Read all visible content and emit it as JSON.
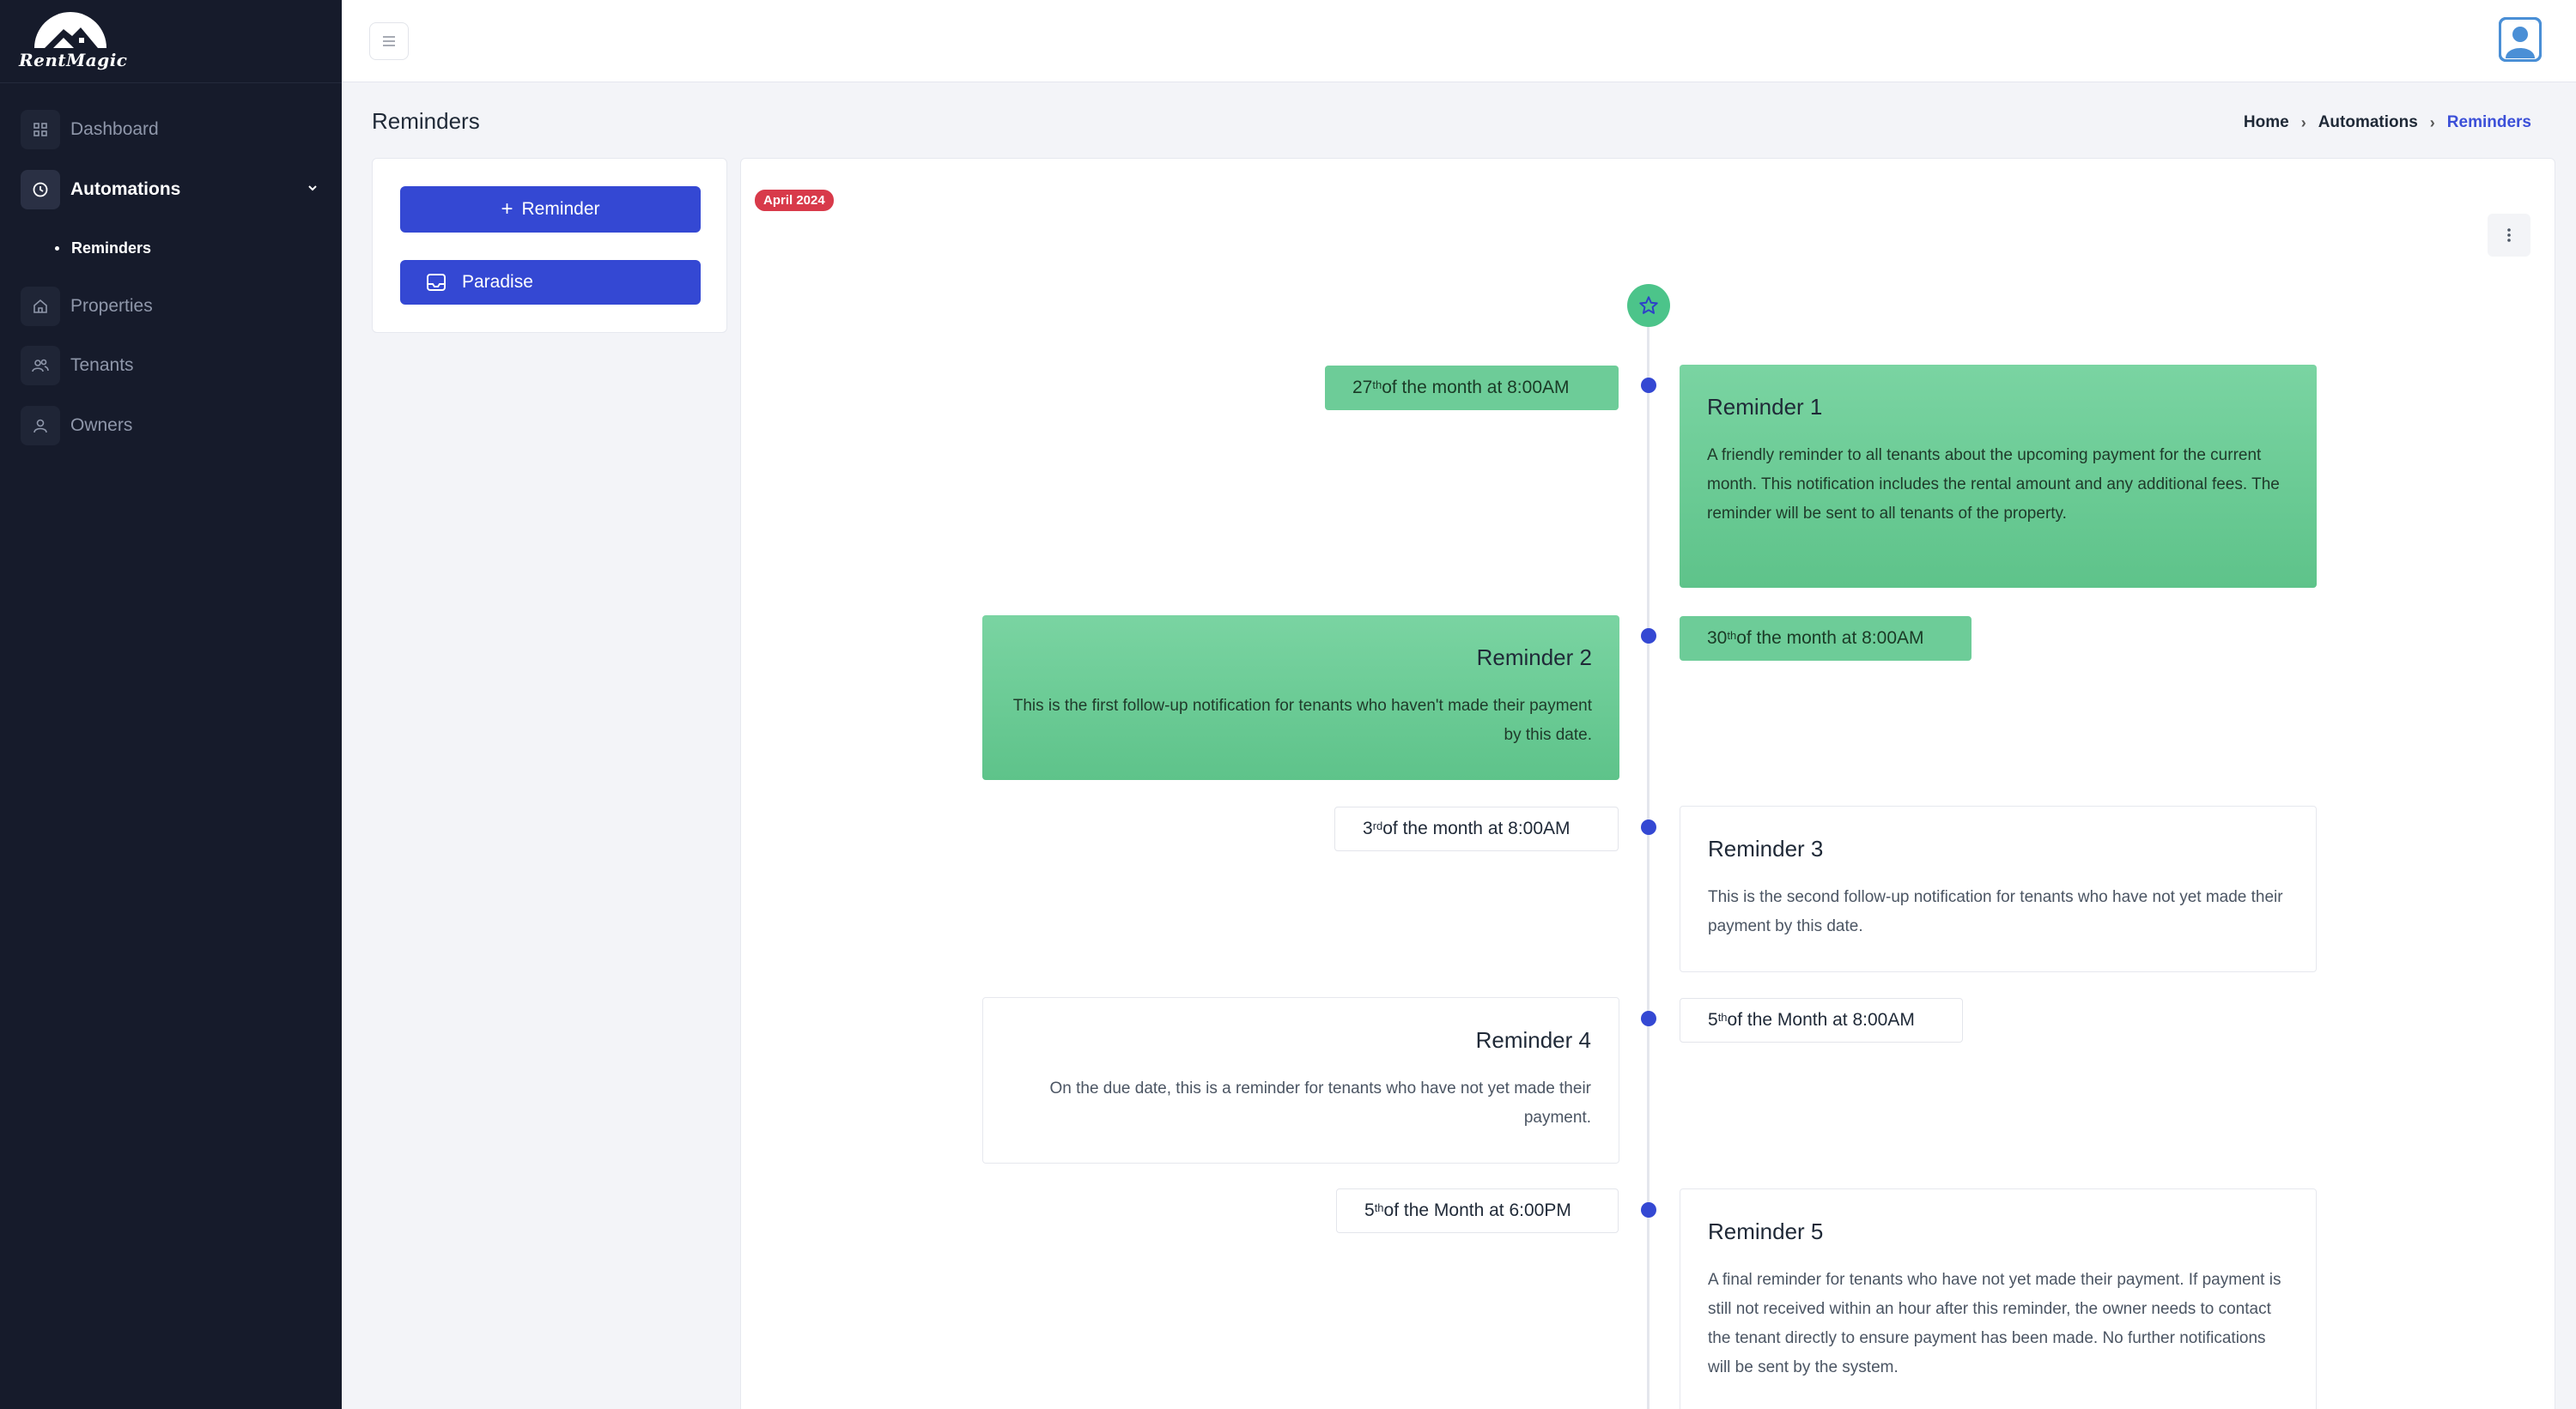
{
  "app": {
    "logo_text": "RentMagic"
  },
  "sidebar": {
    "items": [
      {
        "label": "Dashboard"
      },
      {
        "label": "Automations"
      },
      {
        "label": "Properties"
      },
      {
        "label": "Tenants"
      },
      {
        "label": "Owners"
      }
    ],
    "sub_items": [
      {
        "label": "Reminders"
      }
    ]
  },
  "page": {
    "title": "Reminders",
    "breadcrumb": [
      "Home",
      "Automations",
      "Reminders"
    ]
  },
  "left_panel": {
    "add_button": "Reminder",
    "property_button": "Paradise"
  },
  "timeline": {
    "month_badge": "April 2024",
    "entries": [
      {
        "title": "Reminder 1",
        "date_num": "27",
        "date_sup": "th",
        "date_rest": " of the month at 8:00AM",
        "body": "A friendly reminder to all tenants about the upcoming payment for the current month. This notification includes the rental amount and any additional fees. The reminder will be sent to all tenants of the property."
      },
      {
        "title": "Reminder 2",
        "date_num": "30",
        "date_sup": "th",
        "date_rest": " of the month at 8:00AM",
        "body": "This is the first follow-up notification for tenants who haven't made their payment by this date."
      },
      {
        "title": "Reminder 3",
        "date_num": "3",
        "date_sup": "rd",
        "date_rest": " of the month at 8:00AM",
        "body": "This is the second follow-up notification for tenants who have not yet made their payment by this date."
      },
      {
        "title": "Reminder 4",
        "date_num": "5",
        "date_sup": "th",
        "date_rest": " of the Month at 8:00AM",
        "body": "On the due date, this is a reminder for tenants who have not yet made their payment."
      },
      {
        "title": "Reminder 5",
        "date_num": "5",
        "date_sup": "th",
        "date_rest": " of the Month at 6:00PM",
        "body": "A final reminder for tenants who have not yet made their payment. If payment is still not received within an hour after this reminder, the owner needs to contact the tenant directly to ensure payment has been made. No further notifications will be sent by the system."
      }
    ]
  },
  "colors": {
    "sidebar_bg": "#161b2b",
    "primary": "#3448d3",
    "success": "#5ec38a",
    "badge_red": "#d83a4a"
  },
  "icons": {
    "dashboard": "grid-icon",
    "automations": "clock-icon",
    "properties": "home-icon",
    "tenants": "users-icon",
    "owners": "user-icon",
    "menu": "hamburger-icon",
    "avatar": "user-avatar-icon",
    "timeline_start": "star-icon",
    "more": "kebab-icon",
    "property": "inbox-icon"
  }
}
